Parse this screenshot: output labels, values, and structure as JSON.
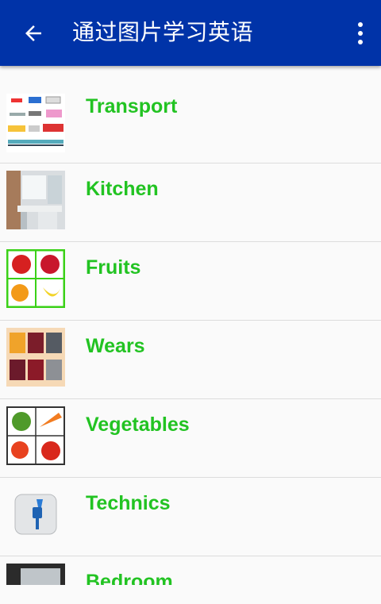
{
  "app_bar": {
    "title": "通过图片学习英语",
    "back_icon": "arrow-back-icon",
    "menu_icon": "more-vert-icon",
    "background": "#0033a8"
  },
  "categories": [
    {
      "label": "Transport",
      "icon": "transport-thumbnail"
    },
    {
      "label": "Kitchen",
      "icon": "kitchen-thumbnail"
    },
    {
      "label": "Fruits",
      "icon": "fruits-thumbnail"
    },
    {
      "label": "Wears",
      "icon": "wears-thumbnail"
    },
    {
      "label": "Vegetables",
      "icon": "vegetables-thumbnail"
    },
    {
      "label": "Technics",
      "icon": "technics-thumbnail"
    },
    {
      "label": "Bedroom",
      "icon": "bedroom-thumbnail"
    }
  ],
  "colors": {
    "label": "#22c322",
    "divider": "#dcdcdc"
  }
}
